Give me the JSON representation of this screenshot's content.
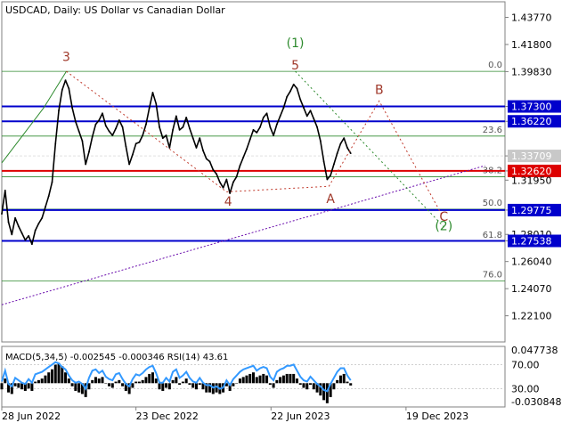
{
  "chart_data": {
    "type": "line",
    "title": "USDCAD, Daily:  US Dollar vs Canadian Dollar",
    "xlabel": "",
    "ylabel": "",
    "x_ticks": [
      "28 Jun 2022",
      "23 Dec 2022",
      "22 Jun 2023",
      "19 Dec 2023"
    ],
    "y_ticks": [
      "1.43770",
      "1.41800",
      "1.39830",
      "1.37300",
      "1.36220",
      "1.33709",
      "1.32620",
      "1.31950",
      "1.29775",
      "1.28010",
      "1.27538",
      "1.26040",
      "1.24070",
      "1.22100"
    ],
    "ylim": [
      1.202,
      1.449
    ],
    "x_range": [
      0,
      600
    ],
    "price_series": [
      [
        0,
        1.295
      ],
      [
        4,
        1.312
      ],
      [
        8,
        1.289
      ],
      [
        12,
        1.28
      ],
      [
        16,
        1.292
      ],
      [
        20,
        1.286
      ],
      [
        24,
        1.281
      ],
      [
        28,
        1.276
      ],
      [
        32,
        1.279
      ],
      [
        36,
        1.273
      ],
      [
        40,
        1.283
      ],
      [
        44,
        1.288
      ],
      [
        48,
        1.292
      ],
      [
        52,
        1.3
      ],
      [
        56,
        1.308
      ],
      [
        60,
        1.318
      ],
      [
        64,
        1.346
      ],
      [
        68,
        1.37
      ],
      [
        72,
        1.385
      ],
      [
        76,
        1.392
      ],
      [
        80,
        1.386
      ],
      [
        84,
        1.372
      ],
      [
        88,
        1.362
      ],
      [
        92,
        1.355
      ],
      [
        96,
        1.348
      ],
      [
        100,
        1.331
      ],
      [
        104,
        1.34
      ],
      [
        108,
        1.351
      ],
      [
        112,
        1.36
      ],
      [
        116,
        1.363
      ],
      [
        120,
        1.368
      ],
      [
        124,
        1.359
      ],
      [
        128,
        1.355
      ],
      [
        132,
        1.352
      ],
      [
        136,
        1.357
      ],
      [
        140,
        1.363
      ],
      [
        144,
        1.358
      ],
      [
        148,
        1.344
      ],
      [
        152,
        1.331
      ],
      [
        156,
        1.338
      ],
      [
        160,
        1.346
      ],
      [
        164,
        1.347
      ],
      [
        168,
        1.352
      ],
      [
        172,
        1.36
      ],
      [
        176,
        1.372
      ],
      [
        180,
        1.383
      ],
      [
        184,
        1.375
      ],
      [
        188,
        1.358
      ],
      [
        192,
        1.35
      ],
      [
        196,
        1.352
      ],
      [
        200,
        1.343
      ],
      [
        204,
        1.356
      ],
      [
        208,
        1.366
      ],
      [
        212,
        1.356
      ],
      [
        216,
        1.358
      ],
      [
        220,
        1.365
      ],
      [
        224,
        1.357
      ],
      [
        228,
        1.35
      ],
      [
        232,
        1.343
      ],
      [
        236,
        1.35
      ],
      [
        240,
        1.341
      ],
      [
        244,
        1.335
      ],
      [
        248,
        1.333
      ],
      [
        252,
        1.327
      ],
      [
        256,
        1.324
      ],
      [
        260,
        1.318
      ],
      [
        264,
        1.314
      ],
      [
        268,
        1.32
      ],
      [
        272,
        1.31
      ],
      [
        276,
        1.318
      ],
      [
        280,
        1.322
      ],
      [
        284,
        1.33
      ],
      [
        288,
        1.336
      ],
      [
        292,
        1.342
      ],
      [
        296,
        1.349
      ],
      [
        300,
        1.356
      ],
      [
        304,
        1.354
      ],
      [
        308,
        1.358
      ],
      [
        312,
        1.365
      ],
      [
        316,
        1.368
      ],
      [
        320,
        1.358
      ],
      [
        324,
        1.352
      ],
      [
        328,
        1.36
      ],
      [
        332,
        1.366
      ],
      [
        336,
        1.372
      ],
      [
        340,
        1.38
      ],
      [
        344,
        1.384
      ],
      [
        348,
        1.389
      ],
      [
        352,
        1.386
      ],
      [
        356,
        1.378
      ],
      [
        360,
        1.372
      ],
      [
        364,
        1.366
      ],
      [
        368,
        1.37
      ],
      [
        372,
        1.364
      ],
      [
        376,
        1.358
      ],
      [
        380,
        1.348
      ],
      [
        384,
        1.333
      ],
      [
        388,
        1.32
      ],
      [
        392,
        1.323
      ],
      [
        396,
        1.331
      ],
      [
        400,
        1.339
      ],
      [
        404,
        1.346
      ],
      [
        408,
        1.35
      ],
      [
        412,
        1.343
      ],
      [
        416,
        1.339
      ]
    ],
    "horizontal_levels": [
      {
        "label": "1.37300",
        "value": 1.373,
        "color": "#0000cc",
        "style": "thick",
        "highlighted": true
      },
      {
        "label": "1.36220",
        "value": 1.3622,
        "color": "#0000cc",
        "style": "thick",
        "highlighted": true
      },
      {
        "label": "1.32620",
        "value": 1.3262,
        "color": "#dd0000",
        "style": "thick",
        "highlighted": true
      },
      {
        "label": "1.29775",
        "value": 1.2978,
        "color": "#0000cc",
        "style": "thick",
        "highlighted": true
      },
      {
        "label": "1.27538",
        "value": 1.2754,
        "color": "#0000cc",
        "style": "thick",
        "highlighted": true
      },
      {
        "label": "1.33709",
        "value": 1.3371,
        "color": "#c8c8c8",
        "style": "current-price",
        "highlighted": false
      }
    ],
    "fibonacci_levels": [
      {
        "label": "0.0",
        "value": 1.3985
      },
      {
        "label": "23.6",
        "value": 1.3515
      },
      {
        "label": "38.2",
        "value": 1.322
      },
      {
        "label": "50.0",
        "value": 1.2984
      },
      {
        "label": "61.8",
        "value": 1.275
      },
      {
        "label": "76.0",
        "value": 1.2462
      }
    ],
    "fib_color": "#2d8a2d",
    "trend_lines": [
      {
        "points": [
          [
            0,
            1.229
          ],
          [
            576,
            1.33
          ]
        ],
        "color": "#6a0dad",
        "style": "dotted"
      },
      {
        "points": [
          [
            0,
            1.332
          ],
          [
            50,
            1.372
          ],
          [
            77,
            1.3985
          ]
        ],
        "color": "#2d8a2d",
        "style": "solid"
      }
    ],
    "wave_paths": [
      {
        "name": "red-dotted",
        "points": [
          [
            77,
            1.3985
          ],
          [
            268,
            1.311
          ],
          [
            390,
            1.315
          ],
          [
            450,
            1.377
          ],
          [
            525,
            1.294
          ]
        ],
        "color": "#c0392b",
        "style": "dotted"
      },
      {
        "name": "green-dotted",
        "points": [
          [
            350,
            1.3985
          ],
          [
            528,
            1.285
          ]
        ],
        "color": "#2d8a2d",
        "style": "dotted"
      }
    ],
    "wave_labels": [
      {
        "text": "3",
        "x": 77,
        "y": 1.406,
        "color": "#a0392b"
      },
      {
        "text": "(1)",
        "x": 350,
        "y": 1.416,
        "color": "#2d8a2d"
      },
      {
        "text": "5",
        "x": 350,
        "y": 1.4,
        "color": "#a0392b"
      },
      {
        "text": "B",
        "x": 450,
        "y": 1.382,
        "color": "#a0392b"
      },
      {
        "text": "4",
        "x": 270,
        "y": 1.301,
        "color": "#a0392b"
      },
      {
        "text": "A",
        "x": 392,
        "y": 1.303,
        "color": "#a0392b"
      },
      {
        "text": "C",
        "x": 527,
        "y": 1.29,
        "color": "#a0392b"
      },
      {
        "text": "(2)",
        "x": 527,
        "y": 1.283,
        "color": "#2d8a2d"
      }
    ],
    "indicator": {
      "label": "MACD(5,34,5) -0.002545 -0.000346 RSI(14) 43.61",
      "y_ticks": [
        "0.047738",
        "70.00",
        "30.00",
        "-0.030848"
      ],
      "hist": [
        [
          0,
          -0.008
        ],
        [
          4,
          0.006
        ],
        [
          8,
          -0.012
        ],
        [
          12,
          -0.014
        ],
        [
          16,
          -0.004
        ],
        [
          20,
          -0.006
        ],
        [
          24,
          -0.008
        ],
        [
          28,
          -0.01
        ],
        [
          32,
          -0.007
        ],
        [
          36,
          -0.01
        ],
        [
          40,
          0.002
        ],
        [
          44,
          0.004
        ],
        [
          48,
          0.006
        ],
        [
          52,
          0.01
        ],
        [
          56,
          0.014
        ],
        [
          60,
          0.018
        ],
        [
          64,
          0.024
        ],
        [
          68,
          0.026
        ],
        [
          72,
          0.022
        ],
        [
          76,
          0.014
        ],
        [
          80,
          0.006
        ],
        [
          84,
          -0.004
        ],
        [
          88,
          -0.01
        ],
        [
          92,
          -0.012
        ],
        [
          96,
          -0.014
        ],
        [
          100,
          -0.018
        ],
        [
          104,
          -0.008
        ],
        [
          108,
          0.004
        ],
        [
          112,
          0.008
        ],
        [
          116,
          0.006
        ],
        [
          120,
          0.008
        ],
        [
          124,
          0.0
        ],
        [
          128,
          -0.004
        ],
        [
          132,
          -0.006
        ],
        [
          136,
          0.002
        ],
        [
          140,
          0.004
        ],
        [
          144,
          -0.004
        ],
        [
          148,
          -0.01
        ],
        [
          152,
          -0.014
        ],
        [
          156,
          -0.006
        ],
        [
          160,
          0.002
        ],
        [
          164,
          0.002
        ],
        [
          168,
          0.004
        ],
        [
          172,
          0.008
        ],
        [
          176,
          0.012
        ],
        [
          180,
          0.014
        ],
        [
          184,
          0.006
        ],
        [
          188,
          -0.008
        ],
        [
          192,
          -0.01
        ],
        [
          196,
          -0.006
        ],
        [
          200,
          -0.008
        ],
        [
          204,
          0.004
        ],
        [
          208,
          0.008
        ],
        [
          212,
          -0.002
        ],
        [
          216,
          0.002
        ],
        [
          220,
          0.006
        ],
        [
          224,
          -0.002
        ],
        [
          228,
          -0.006
        ],
        [
          232,
          -0.008
        ],
        [
          236,
          -0.002
        ],
        [
          240,
          -0.008
        ],
        [
          244,
          -0.012
        ],
        [
          248,
          -0.012
        ],
        [
          252,
          -0.014
        ],
        [
          256,
          -0.012
        ],
        [
          260,
          -0.014
        ],
        [
          264,
          -0.012
        ],
        [
          268,
          -0.004
        ],
        [
          272,
          -0.01
        ],
        [
          276,
          -0.004
        ],
        [
          280,
          0.0
        ],
        [
          284,
          0.006
        ],
        [
          288,
          0.008
        ],
        [
          292,
          0.01
        ],
        [
          296,
          0.012
        ],
        [
          300,
          0.014
        ],
        [
          304,
          0.008
        ],
        [
          308,
          0.01
        ],
        [
          312,
          0.012
        ],
        [
          316,
          0.01
        ],
        [
          320,
          -0.002
        ],
        [
          324,
          -0.006
        ],
        [
          328,
          0.004
        ],
        [
          332,
          0.008
        ],
        [
          336,
          0.01
        ],
        [
          340,
          0.012
        ],
        [
          344,
          0.012
        ],
        [
          348,
          0.012
        ],
        [
          352,
          0.006
        ],
        [
          356,
          -0.002
        ],
        [
          360,
          -0.006
        ],
        [
          364,
          -0.008
        ],
        [
          368,
          -0.002
        ],
        [
          372,
          -0.008
        ],
        [
          376,
          -0.012
        ],
        [
          380,
          -0.016
        ],
        [
          384,
          -0.022
        ],
        [
          388,
          -0.026
        ],
        [
          392,
          -0.018
        ],
        [
          396,
          -0.008
        ],
        [
          400,
          0.004
        ],
        [
          404,
          0.01
        ],
        [
          408,
          0.012
        ],
        [
          412,
          0.002
        ],
        [
          416,
          -0.003
        ]
      ],
      "hist_range": [
        -0.030848,
        0.047738
      ],
      "rsi": [
        [
          0,
          42
        ],
        [
          4,
          60
        ],
        [
          8,
          38
        ],
        [
          12,
          34
        ],
        [
          16,
          48
        ],
        [
          20,
          44
        ],
        [
          24,
          40
        ],
        [
          28,
          38
        ],
        [
          32,
          46
        ],
        [
          36,
          40
        ],
        [
          40,
          54
        ],
        [
          44,
          56
        ],
        [
          48,
          58
        ],
        [
          52,
          62
        ],
        [
          56,
          66
        ],
        [
          60,
          70
        ],
        [
          64,
          74
        ],
        [
          68,
          72
        ],
        [
          72,
          66
        ],
        [
          76,
          62
        ],
        [
          80,
          52
        ],
        [
          84,
          44
        ],
        [
          88,
          40
        ],
        [
          92,
          42
        ],
        [
          96,
          38
        ],
        [
          100,
          30
        ],
        [
          104,
          48
        ],
        [
          108,
          60
        ],
        [
          112,
          62
        ],
        [
          116,
          56
        ],
        [
          120,
          60
        ],
        [
          124,
          50
        ],
        [
          128,
          46
        ],
        [
          132,
          44
        ],
        [
          136,
          54
        ],
        [
          140,
          56
        ],
        [
          144,
          46
        ],
        [
          148,
          38
        ],
        [
          152,
          34
        ],
        [
          156,
          46
        ],
        [
          160,
          54
        ],
        [
          164,
          52
        ],
        [
          168,
          56
        ],
        [
          172,
          62
        ],
        [
          176,
          66
        ],
        [
          180,
          68
        ],
        [
          184,
          56
        ],
        [
          188,
          40
        ],
        [
          192,
          40
        ],
        [
          196,
          48
        ],
        [
          200,
          42
        ],
        [
          204,
          58
        ],
        [
          208,
          62
        ],
        [
          212,
          48
        ],
        [
          216,
          52
        ],
        [
          220,
          58
        ],
        [
          224,
          48
        ],
        [
          228,
          42
        ],
        [
          232,
          40
        ],
        [
          236,
          48
        ],
        [
          240,
          40
        ],
        [
          244,
          36
        ],
        [
          248,
          36
        ],
        [
          252,
          32
        ],
        [
          256,
          34
        ],
        [
          260,
          30
        ],
        [
          264,
          32
        ],
        [
          268,
          44
        ],
        [
          272,
          36
        ],
        [
          276,
          46
        ],
        [
          280,
          52
        ],
        [
          284,
          58
        ],
        [
          288,
          62
        ],
        [
          292,
          64
        ],
        [
          296,
          66
        ],
        [
          300,
          68
        ],
        [
          304,
          60
        ],
        [
          308,
          64
        ],
        [
          312,
          66
        ],
        [
          316,
          64
        ],
        [
          320,
          50
        ],
        [
          324,
          44
        ],
        [
          328,
          58
        ],
        [
          332,
          62
        ],
        [
          336,
          64
        ],
        [
          340,
          68
        ],
        [
          344,
          68
        ],
        [
          348,
          70
        ],
        [
          352,
          60
        ],
        [
          356,
          50
        ],
        [
          360,
          44
        ],
        [
          364,
          42
        ],
        [
          368,
          50
        ],
        [
          372,
          44
        ],
        [
          376,
          38
        ],
        [
          380,
          34
        ],
        [
          384,
          28
        ],
        [
          388,
          26
        ],
        [
          392,
          38
        ],
        [
          396,
          48
        ],
        [
          400,
          58
        ],
        [
          404,
          64
        ],
        [
          408,
          64
        ],
        [
          412,
          52
        ],
        [
          416,
          44
        ]
      ],
      "rsi_range": [
        0,
        100
      ],
      "rsi_color": "#3399ff"
    }
  }
}
